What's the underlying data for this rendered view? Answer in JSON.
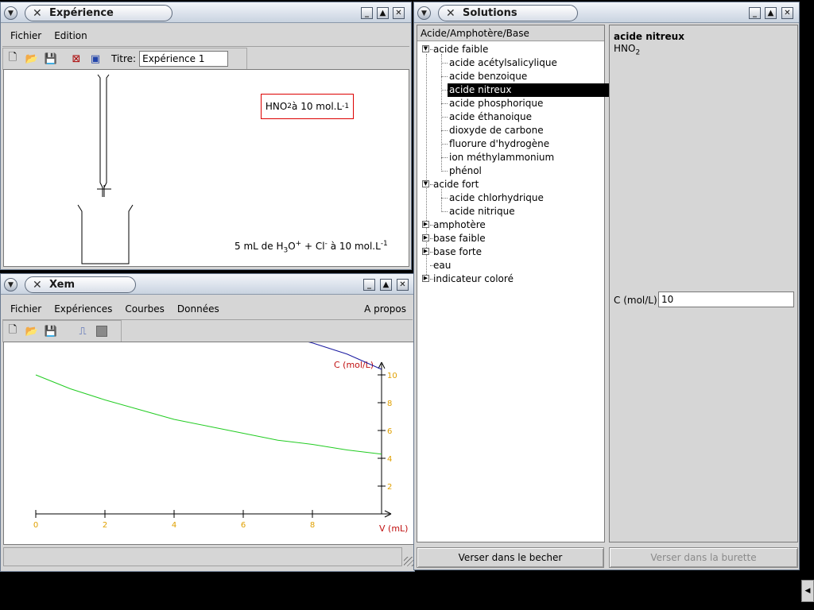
{
  "experience_window": {
    "title": "Expérience",
    "menu": [
      "Fichier",
      "Edition"
    ],
    "titre_label": "Titre:",
    "titre_value": "Expérience 1",
    "flask_label_formula": "HNO",
    "flask_label_sub": "2",
    "flask_label_rest": " à 10 mol.L",
    "flask_label_sup": "-1",
    "beaker_label_pre": "5 mL de H",
    "beaker_label_sub1": "3",
    "beaker_label_mid": "O",
    "beaker_label_sup1": "+",
    "beaker_label_mid2": " + Cl",
    "beaker_label_sup2": "-",
    "beaker_label_rest": " à 10 mol.L",
    "beaker_label_sup3": "-1"
  },
  "xem_window": {
    "title": "Xem",
    "menu": [
      "Fichier",
      "Expériences",
      "Courbes",
      "Données"
    ],
    "about": "A propos",
    "status": ""
  },
  "solutions_window": {
    "title": "Solutions",
    "tree_header": "Acide/Amphotère/Base",
    "categories": [
      {
        "label": "acide faible",
        "expanded": true,
        "children": [
          "acide acétylsalicylique",
          "acide benzoique",
          "acide nitreux",
          "acide phosphorique",
          "acide éthanoique",
          "dioxyde de carbone",
          "fluorure d'hydrogène",
          "ion méthylammonium",
          "phénol"
        ]
      },
      {
        "label": "acide fort",
        "expanded": true,
        "children": [
          "acide chlorhydrique",
          "acide nitrique"
        ]
      },
      {
        "label": "amphotère",
        "expanded": false,
        "children": []
      },
      {
        "label": "base faible",
        "expanded": false,
        "children": []
      },
      {
        "label": "base forte",
        "expanded": false,
        "children": []
      },
      {
        "label": "eau",
        "expanded": null,
        "children": []
      },
      {
        "label": "indicateur coloré",
        "expanded": false,
        "children": []
      }
    ],
    "selected": "acide nitreux",
    "detail_name": "acide nitreux",
    "detail_formula": "HNO",
    "detail_formula_sub": "2",
    "conc_label": "C (mol/L):",
    "conc_value": "10",
    "btn_becher": "Verser dans le becher",
    "btn_burette": "Verser dans la burette"
  },
  "chart_data": {
    "type": "line",
    "xlabel": "V (mL)",
    "ylabel": "C (mol/L)",
    "xlim": [
      0,
      10
    ],
    "ylim": [
      0,
      10
    ],
    "x_ticks": [
      0,
      2,
      4,
      6,
      8
    ],
    "y_ticks": [
      2,
      4,
      6,
      8,
      10
    ],
    "series": [
      {
        "color": "#22cc22",
        "x": [
          0,
          0.5,
          1,
          2,
          3,
          4,
          5,
          6,
          7,
          8,
          9,
          10
        ],
        "y": [
          10,
          9.5,
          9.0,
          8.2,
          7.5,
          6.8,
          6.3,
          5.8,
          5.3,
          5.0,
          4.6,
          4.3
        ]
      },
      {
        "color": "#1a1aa0",
        "x": [
          6.4,
          7,
          8,
          9,
          10
        ],
        "y": [
          13.2,
          12.9,
          12.3,
          11.5,
          10.4
        ]
      }
    ]
  }
}
